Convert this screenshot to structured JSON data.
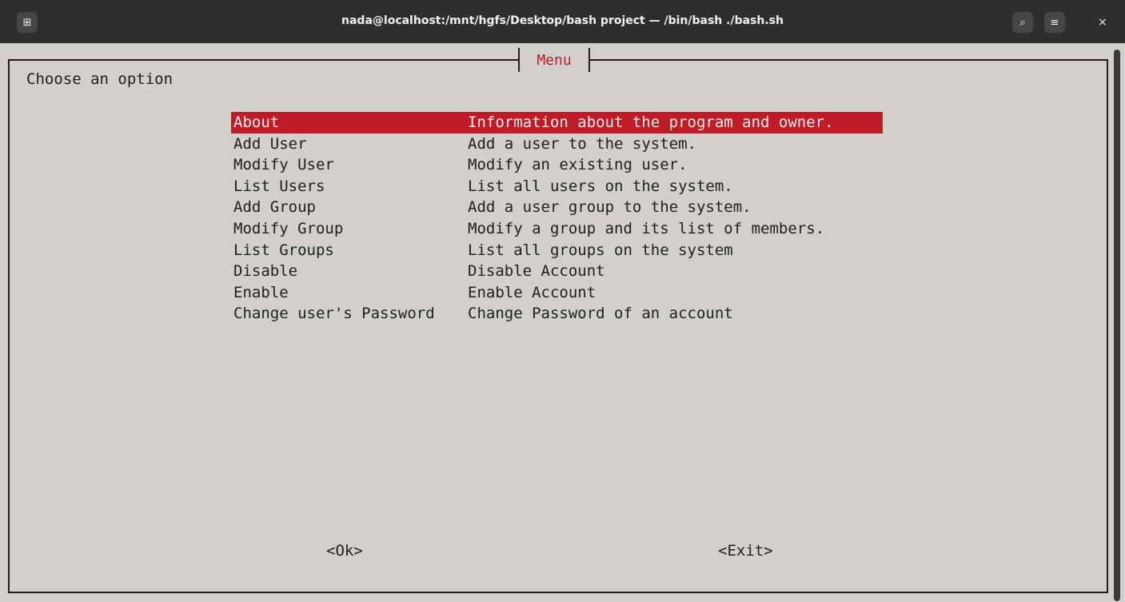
{
  "window": {
    "title": "nada@localhost:/mnt/hgfs/Desktop/bash project — /bin/bash ./bash.sh",
    "new_tab_icon": "⊞",
    "search_icon": "⌕",
    "menu_icon": "≡",
    "close_icon": "×"
  },
  "dialog": {
    "title": "Menu",
    "prompt": "Choose an option",
    "items": [
      {
        "tag": "About",
        "desc": "Information about the program and owner."
      },
      {
        "tag": "Add User",
        "desc": "Add a user to the system."
      },
      {
        "tag": "Modify User",
        "desc": "Modify an existing user."
      },
      {
        "tag": "List Users",
        "desc": "List all users on the system."
      },
      {
        "tag": "Add Group",
        "desc": "Add a user group to the system."
      },
      {
        "tag": "Modify Group",
        "desc": "Modify a group and its list of members."
      },
      {
        "tag": "List Groups",
        "desc": "List all groups on the system"
      },
      {
        "tag": "Disable",
        "desc": "Disable Account"
      },
      {
        "tag": "Enable",
        "desc": "Enable Account"
      },
      {
        "tag": "Change user's Password",
        "desc": "Change Password of an account"
      }
    ],
    "selected_index": 0,
    "ok_label": "<Ok>",
    "exit_label": "<Exit>"
  },
  "colors": {
    "terminal_bg": "#d3d0cc",
    "highlight": "#c01c28",
    "titlebar": "#2e2e2e"
  }
}
